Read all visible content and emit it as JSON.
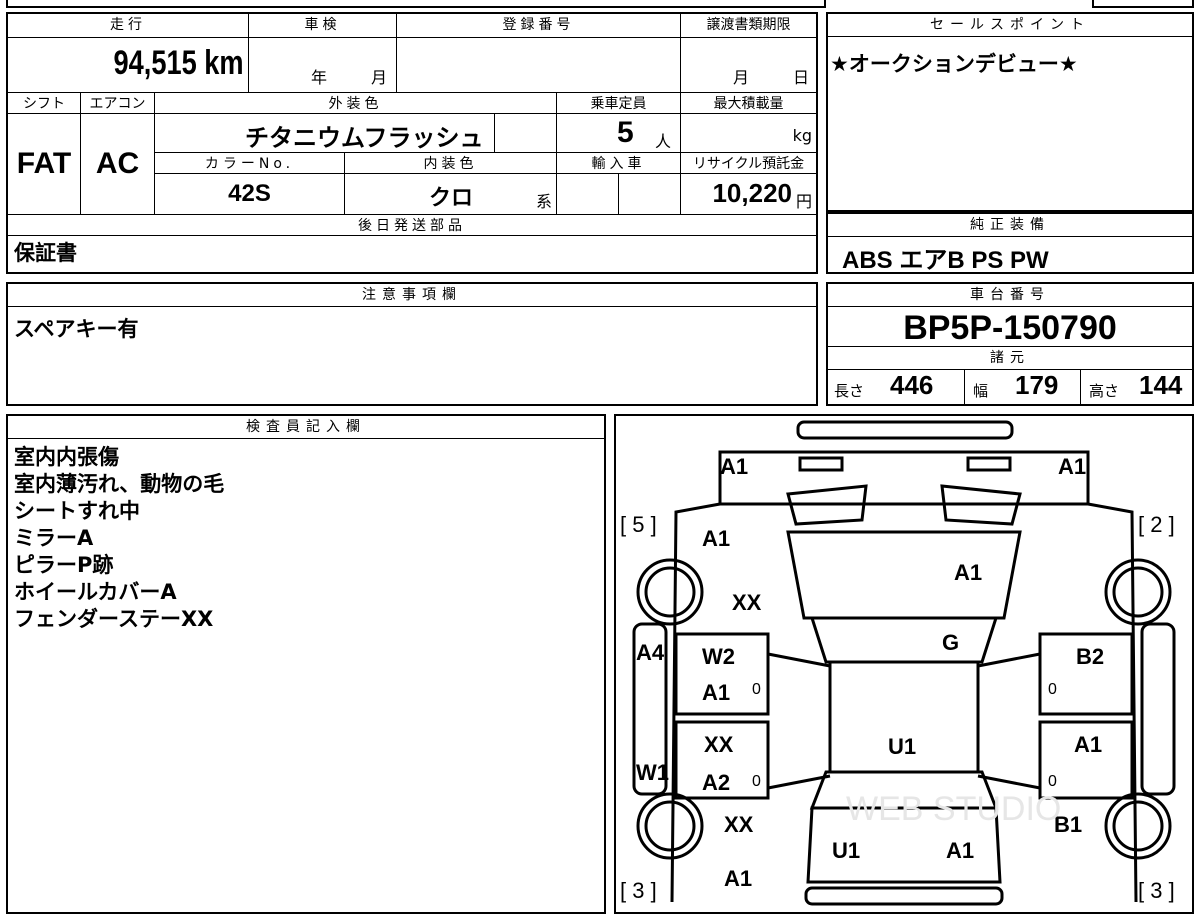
{
  "top_cut": {
    "cells": [
      "",
      "",
      "",
      "",
      ""
    ]
  },
  "vehicle": {
    "mileage_label": "走行",
    "mileage_value": "94,515",
    "mileage_unit": "km",
    "inspection_label": "車検",
    "inspection_year": "年",
    "inspection_month": "月",
    "registration_label": "登録番号",
    "transfer_label": "譲渡書類期限",
    "transfer_month": "月",
    "transfer_day": "日",
    "shift_label": "シフト",
    "shift_value": "FAT",
    "ac_label": "エアコン",
    "ac_value": "AC",
    "exterior_color_label": "外装色",
    "exterior_color_value": "チタニウムフラッシュ",
    "capacity_label": "乗車定員",
    "capacity_value": "5",
    "capacity_unit": "人",
    "max_load_label": "最大積載量",
    "max_load_unit": "kg",
    "color_no_label": "カラーNo.",
    "color_no_value": "42S",
    "interior_color_label": "内装色",
    "interior_color_value": "クロ",
    "interior_color_suffix": "系",
    "import_label": "輸入車",
    "recycle_label": "リサイクル預託金",
    "recycle_value": "10,220",
    "recycle_unit": "円"
  },
  "sales_point": {
    "label": "セールスポイント",
    "text": "★オークションデビュー★"
  },
  "later_parts": {
    "label": "後日発送部品",
    "text": "保証書"
  },
  "equipment": {
    "label": "純正装備",
    "text": "ABS エアB PS PW"
  },
  "caution": {
    "label": "注意事項欄",
    "text": "スペアキー有"
  },
  "chassis": {
    "label": "車台番号",
    "value": "BP5P-150790"
  },
  "specs": {
    "label": "諸元",
    "length_label": "長さ",
    "length_value": "446",
    "width_label": "幅",
    "width_value": "179",
    "height_label": "高さ",
    "height_value": "144"
  },
  "inspector": {
    "label": "検査員記入欄",
    "lines": [
      "室内内張傷",
      "室内薄汚れ、動物の毛",
      "シートすれ中",
      "ミラーA",
      "ピラーP跡",
      "ホイールカバーA",
      "フェンダーステーXX"
    ]
  },
  "damage_map": {
    "marks": {
      "front_left_corner": "A1",
      "front_right_corner": "A1",
      "left_front_fender": "A1",
      "left_front_wheel_area": "XX",
      "hood": "A1",
      "windshield": "G",
      "left_pillar": "A4",
      "left_rocker": "W1",
      "left_front_door_top": "W2",
      "left_front_door": "A1",
      "left_rear_door_top": "XX",
      "left_rear_door": "A2",
      "right_front_door": "B2",
      "right_rear_door": "A1",
      "roof": "U1",
      "right_rear_wheel_area": "B1",
      "left_rear_wheel_area": "XX",
      "trunk_left": "U1",
      "trunk_right": "A1",
      "rear_left_corner": "A1"
    },
    "tire_labels": {
      "front_left": "[ 5 ]",
      "front_right": "[ 2 ]",
      "rear_left": "[ 3 ]",
      "rear_right": "[ 3 ]"
    },
    "door_zeros": [
      "0",
      "0",
      "0",
      "0"
    ],
    "watermark": "WEB STUDIO"
  }
}
